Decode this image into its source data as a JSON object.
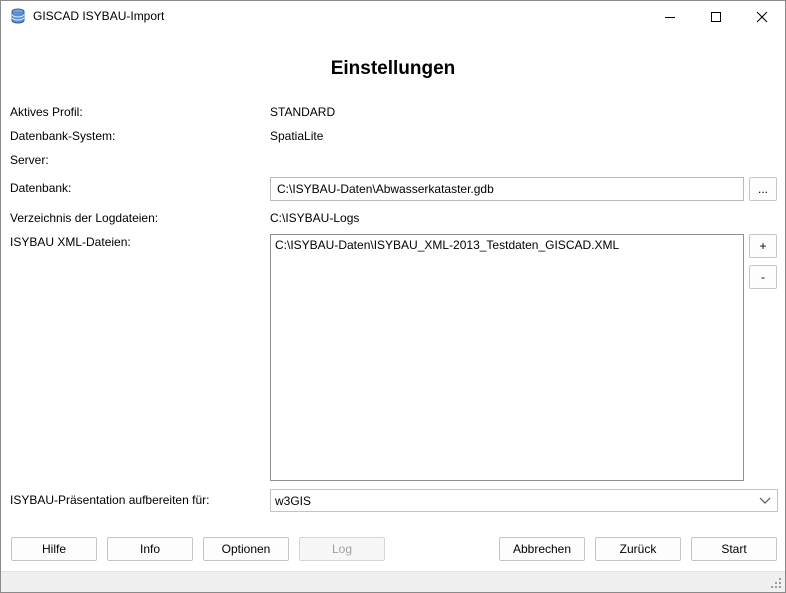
{
  "window": {
    "title": "GISCAD ISYBAU-Import",
    "app_icon": "database-icon",
    "controls": [
      "minimize-icon",
      "maximize-icon",
      "close-icon"
    ]
  },
  "heading": "Einstellungen",
  "form": {
    "profile_label": "Aktives Profil:",
    "profile_value": "STANDARD",
    "dbsystem_label": "Datenbank-System:",
    "dbsystem_value": "SpatiaLite",
    "server_label": "Server:",
    "database_label": "Datenbank:",
    "database_value": "C:\\ISYBAU-Daten\\Abwasserkataster.gdb",
    "browse_label": "...",
    "logdir_label": "Verzeichnis der Logdateien:",
    "logdir_value": "C:\\ISYBAU-Logs",
    "xml_label": "ISYBAU XML-Dateien:",
    "xml_files": [
      "C:\\ISYBAU-Daten\\ISYBAU_XML-2013_Testdaten_GISCAD.XML"
    ],
    "add_label": "+",
    "remove_label": "-",
    "presentation_label": "ISYBAU-Präsentation aufbereiten für:",
    "presentation_value": "w3GIS"
  },
  "buttons": {
    "help": "Hilfe",
    "info": "Info",
    "options": "Optionen",
    "log": "Log",
    "cancel": "Abbrechen",
    "back": "Zurück",
    "start": "Start"
  },
  "colors": {
    "window_bg": "#ffffff",
    "statusbar_bg": "#f0f0f0",
    "disabled_text": "#a0a0a0",
    "icon_blue": "#2f5d9e"
  }
}
